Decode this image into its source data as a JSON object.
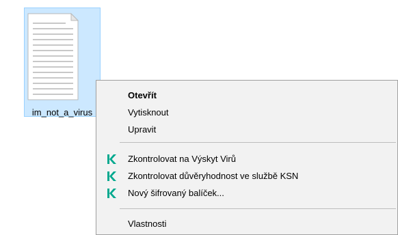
{
  "file": {
    "name": "im_not_a_virus",
    "icon": "document-icon"
  },
  "context_menu": {
    "items": [
      {
        "label": "Otevřít",
        "bold": true,
        "icon": ""
      },
      {
        "label": "Vytisknout",
        "bold": false,
        "icon": ""
      },
      {
        "label": "Upravit",
        "bold": false,
        "icon": ""
      },
      {
        "label": "Zkontrolovat na Výskyt Virů",
        "bold": false,
        "icon": "kaspersky-icon"
      },
      {
        "label": "Zkontrolovat důvěryhodnost ve službě KSN",
        "bold": false,
        "icon": "kaspersky-icon"
      },
      {
        "label": "Nový šifrovaný balíček...",
        "bold": false,
        "icon": "kaspersky-icon"
      },
      {
        "label": "Vlastnosti",
        "bold": false,
        "icon": ""
      }
    ]
  },
  "colors": {
    "selection_bg": "#cce8ff",
    "selection_border": "#99d1ff",
    "menu_bg": "#f2f2f2",
    "kaspersky_green": "#00a88e"
  }
}
